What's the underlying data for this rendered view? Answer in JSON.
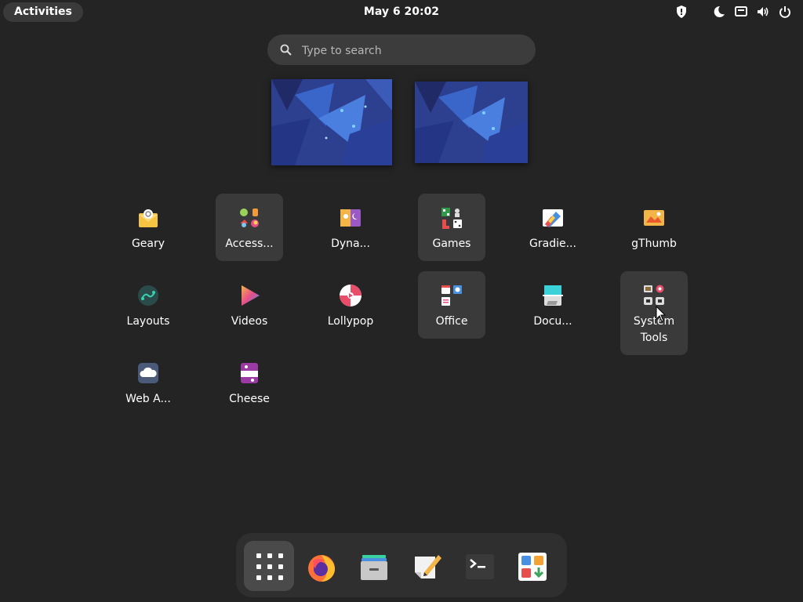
{
  "topbar": {
    "activities_label": "Activities",
    "clock": "May 6  20:02",
    "tray_icons": [
      "privacy-shield-icon",
      "night-light-icon",
      "network-wired-icon",
      "volume-icon",
      "power-icon"
    ]
  },
  "search": {
    "placeholder": "Type to search"
  },
  "apps": [
    {
      "label": "Geary",
      "icon": "geary-mail-icon"
    },
    {
      "label": "Access...",
      "icon": "accessories-folder-icon"
    },
    {
      "label": "Dyna...",
      "icon": "dynamic-wallpaper-icon"
    },
    {
      "label": "Games",
      "icon": "games-folder-icon"
    },
    {
      "label": "Gradie...",
      "icon": "gradience-icon"
    },
    {
      "label": "gThumb",
      "icon": "gthumb-icon"
    },
    {
      "label": "Layouts",
      "icon": "layouts-icon"
    },
    {
      "label": "Videos",
      "icon": "videos-icon"
    },
    {
      "label": "Lollypop",
      "icon": "lollypop-icon"
    },
    {
      "label": "Office",
      "icon": "office-folder-icon"
    },
    {
      "label": "Docu...",
      "icon": "document-scanner-icon"
    },
    {
      "label": "System\nTools",
      "icon": "system-tools-folder-icon"
    },
    {
      "label": "Web A...",
      "icon": "web-apps-icon"
    },
    {
      "label": "Cheese",
      "icon": "cheese-icon"
    }
  ],
  "dock": [
    {
      "name": "show-apps",
      "icon": "app-grid-icon"
    },
    {
      "name": "firefox",
      "icon": "firefox-icon"
    },
    {
      "name": "files",
      "icon": "files-icon"
    },
    {
      "name": "text-editor",
      "icon": "text-editor-icon"
    },
    {
      "name": "terminal",
      "icon": "terminal-icon"
    },
    {
      "name": "software",
      "icon": "software-icon"
    }
  ]
}
